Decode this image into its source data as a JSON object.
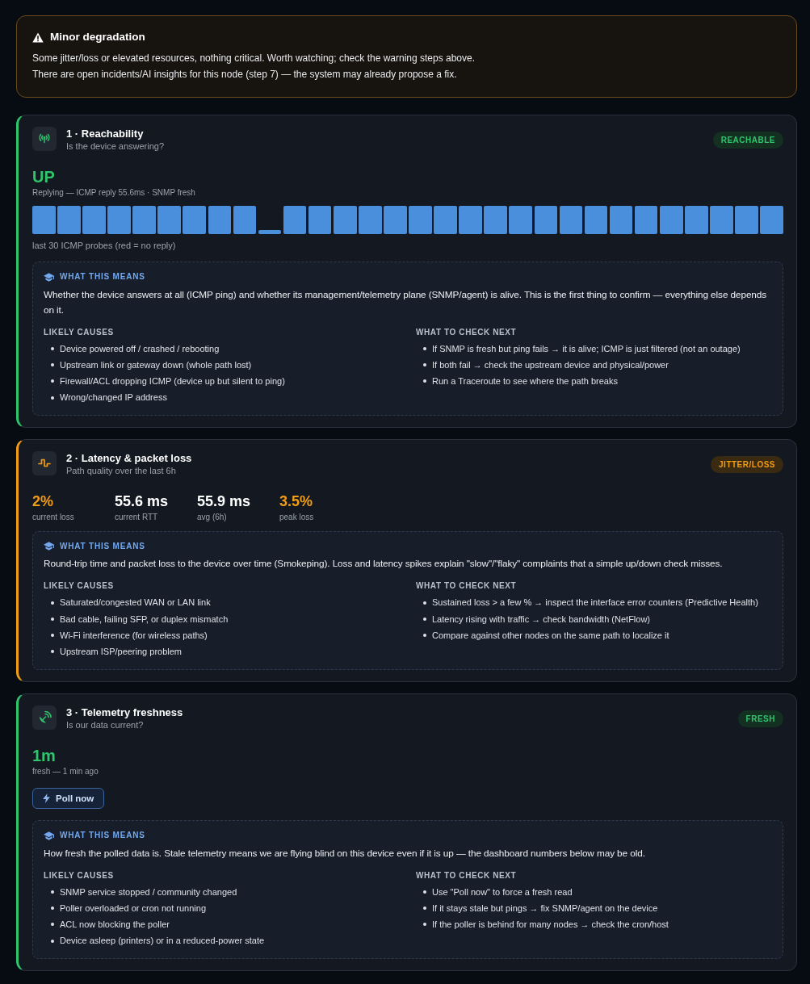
{
  "alert": {
    "warning": true,
    "title": "Minor degradation",
    "lines": [
      "Some jitter/loss or elevated resources, nothing critical. Worth watching; check the warning steps above.",
      "There are open incidents/AI insights for this node (step 7) — the system may already propose a fix."
    ]
  },
  "cards": [
    {
      "kind": "probes",
      "warning": false,
      "title": "1 · Reachability",
      "subtitle": "Is the device answering?",
      "badge": "REACHABLE",
      "value": "UP",
      "value_caption": "Replying — ICMP reply 55.6ms · SNMP fresh",
      "probes": [
        {
          "replied": true,
          "kind": "full"
        },
        {
          "replied": true,
          "kind": "full"
        },
        {
          "replied": true,
          "kind": "full"
        },
        {
          "replied": true,
          "kind": "full"
        },
        {
          "replied": true,
          "kind": "full"
        },
        {
          "replied": true,
          "kind": "full"
        },
        {
          "replied": true,
          "kind": "full"
        },
        {
          "replied": true,
          "kind": "full"
        },
        {
          "replied": true,
          "kind": "full"
        },
        {
          "replied": true,
          "kind": "stub"
        },
        {
          "replied": true,
          "kind": "full"
        },
        {
          "replied": true,
          "kind": "full"
        },
        {
          "replied": true,
          "kind": "full"
        },
        {
          "replied": true,
          "kind": "full"
        },
        {
          "replied": true,
          "kind": "full"
        },
        {
          "replied": true,
          "kind": "full"
        },
        {
          "replied": true,
          "kind": "full"
        },
        {
          "replied": true,
          "kind": "full"
        },
        {
          "replied": true,
          "kind": "full"
        },
        {
          "replied": true,
          "kind": "full"
        },
        {
          "replied": true,
          "kind": "full"
        },
        {
          "replied": true,
          "kind": "full"
        },
        {
          "replied": true,
          "kind": "full"
        },
        {
          "replied": true,
          "kind": "full"
        },
        {
          "replied": true,
          "kind": "full"
        },
        {
          "replied": true,
          "kind": "full"
        },
        {
          "replied": true,
          "kind": "full"
        },
        {
          "replied": true,
          "kind": "full"
        },
        {
          "replied": true,
          "kind": "full"
        },
        {
          "replied": true,
          "kind": "full"
        }
      ],
      "probes_caption": "last 30 ICMP probes (red = no reply)",
      "help": {
        "heading": "WHAT THIS MEANS",
        "text": "Whether the device answers at all (ICMP ping) and whether its management/telemetry plane (SNMP/agent) is alive. This is the first thing to confirm — everything else depends on it.",
        "columns": [
          {
            "heading": "LIKELY CAUSES",
            "items": [
              "Device powered off / crashed / rebooting",
              "Upstream link or gateway down (whole path lost)",
              "Firewall/ACL dropping ICMP (device up but silent to ping)",
              "Wrong/changed IP address"
            ]
          },
          {
            "heading": "WHAT TO CHECK NEXT",
            "items": [
              "If SNMP is fresh but ping fails → it is alive; ICMP is just filtered (not an outage)",
              "If both fail → check the upstream device and physical/power",
              "Run a Traceroute to see where the path breaks"
            ]
          }
        ]
      }
    },
    {
      "kind": "stats",
      "warning": true,
      "title": "2 · Latency & packet loss",
      "subtitle": "Path quality over the last 6h",
      "badge": "JITTER/LOSS",
      "stats": [
        {
          "value": "2%",
          "label": "current loss",
          "warn": true
        },
        {
          "value": "55.6 ms",
          "label": "current RTT",
          "warn": false
        },
        {
          "value": "55.9 ms",
          "label": "avg (6h)",
          "warn": false
        },
        {
          "value": "3.5%",
          "label": "peak loss",
          "warn": true
        }
      ],
      "help": {
        "heading": "WHAT THIS MEANS",
        "text": "Round-trip time and packet loss to the device over time (Smokeping). Loss and latency spikes explain \"slow\"/\"flaky\" complaints that a simple up/down check misses.",
        "columns": [
          {
            "heading": "LIKELY CAUSES",
            "items": [
              "Saturated/congested WAN or LAN link",
              "Bad cable, failing SFP, or duplex mismatch",
              "Wi-Fi interference (for wireless paths)",
              "Upstream ISP/peering problem"
            ]
          },
          {
            "heading": "WHAT TO CHECK NEXT",
            "items": [
              "Sustained loss > a few % → inspect the interface error counters (Predictive Health)",
              "Latency rising with traffic → check bandwidth (NetFlow)",
              "Compare against other nodes on the same path to localize it"
            ]
          }
        ]
      }
    },
    {
      "kind": "freshness",
      "warning": false,
      "title": "3 · Telemetry freshness",
      "subtitle": "Is our data current?",
      "badge": "FRESH",
      "value": "1m",
      "value_caption": "fresh — 1 min ago",
      "button": "Poll now",
      "help": {
        "heading": "WHAT THIS MEANS",
        "text": "How fresh the polled data is. Stale telemetry means we are flying blind on this device even if it is up — the dashboard numbers below may be old.",
        "columns": [
          {
            "heading": "LIKELY CAUSES",
            "items": [
              "SNMP service stopped / community changed",
              "Poller overloaded or cron not running",
              "ACL now blocking the poller",
              "Device asleep (printers) or in a reduced-power state"
            ]
          },
          {
            "heading": "WHAT TO CHECK NEXT",
            "items": [
              "Use \"Poll now\" to force a fresh read",
              "If it stays stale but pings → fix SNMP/agent on the device",
              "If the poller is behind for many nodes → check the cron/host"
            ]
          }
        ]
      }
    }
  ]
}
